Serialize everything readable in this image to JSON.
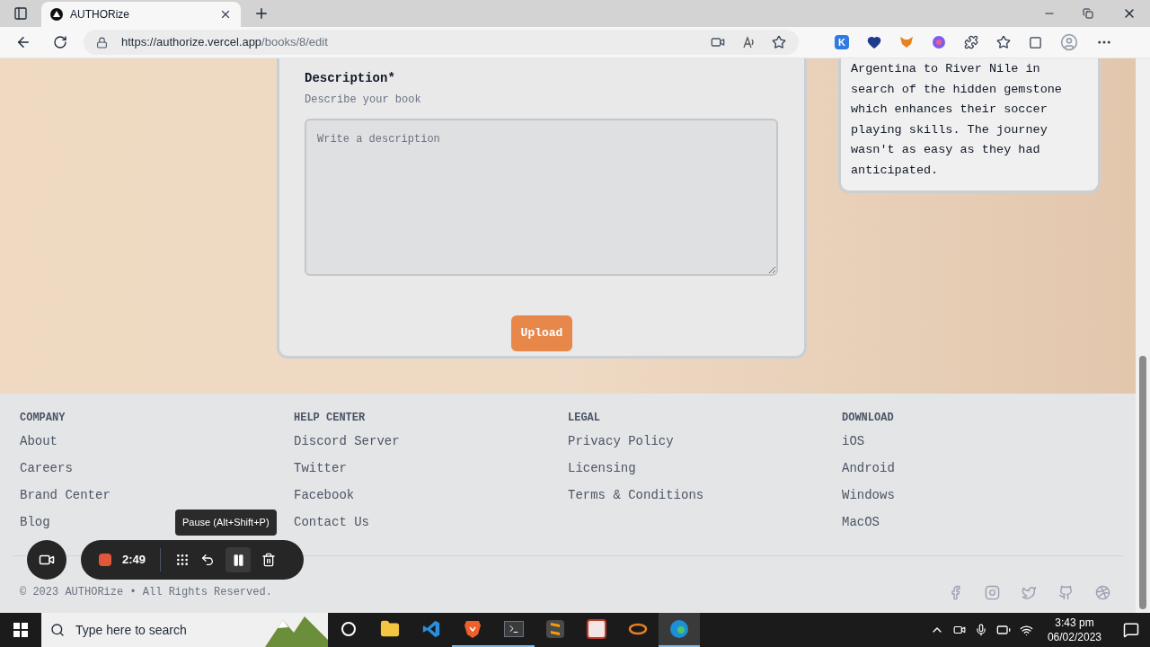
{
  "browser": {
    "tabs": [
      {
        "title": "AUTHORize",
        "selected": true
      }
    ],
    "url_host": "https://authorize.vercel.app",
    "url_path": "/books/8/edit",
    "extension_letter": "K"
  },
  "form": {
    "label": "Description*",
    "hint": "Describe your book",
    "placeholder": "Write a description",
    "button": "Upload"
  },
  "preview_text": "Argentina to River Nile in search of the hidden gemstone which enhances their soccer playing skills. The journey wasn't as easy as they had anticipated.",
  "footer": {
    "columns": [
      {
        "heading": "COMPANY",
        "links": [
          "About",
          "Careers",
          "Brand Center",
          "Blog"
        ]
      },
      {
        "heading": "HELP CENTER",
        "links": [
          "Discord Server",
          "Twitter",
          "Facebook",
          "Contact Us"
        ]
      },
      {
        "heading": "LEGAL",
        "links": [
          "Privacy Policy",
          "Licensing",
          "Terms & Conditions"
        ]
      },
      {
        "heading": "DOWNLOAD",
        "links": [
          "iOS",
          "Android",
          "Windows",
          "MacOS"
        ]
      }
    ],
    "copyright": "© 2023 AUTHORize • All Rights Reserved."
  },
  "recorder": {
    "time": "2:49",
    "tooltip": "Pause (Alt+Shift+P)"
  },
  "taskbar": {
    "search_placeholder": "Type here to search",
    "apps": [
      {
        "kind": "cortana",
        "running": false,
        "selected": false
      },
      {
        "kind": "explorer",
        "running": false,
        "selected": false
      },
      {
        "kind": "vscode",
        "running": false,
        "selected": false
      },
      {
        "kind": "brave",
        "running": true,
        "selected": false
      },
      {
        "kind": "terminal",
        "running": true,
        "selected": false
      },
      {
        "kind": "sublime",
        "running": false,
        "selected": false
      },
      {
        "kind": "ks",
        "running": false,
        "selected": false
      },
      {
        "kind": "ring",
        "running": false,
        "selected": false
      },
      {
        "kind": "edge",
        "running": true,
        "selected": true
      }
    ],
    "time": "3:43 pm",
    "date": "06/02/2023"
  }
}
